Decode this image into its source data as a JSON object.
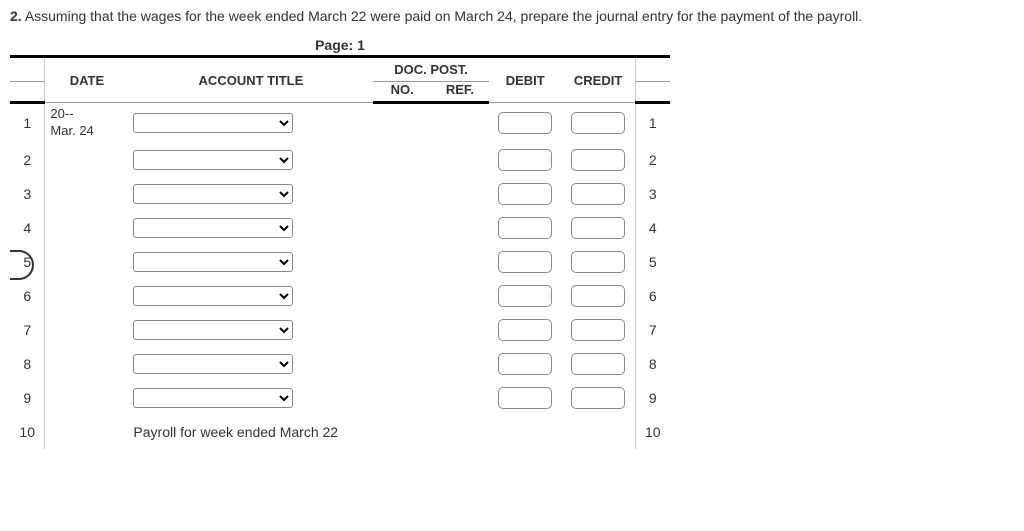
{
  "question": {
    "number": "2.",
    "text": "Assuming that the wages for the week ended March 22 were paid on March 24, prepare the journal entry for the payment of the payroll."
  },
  "page_label": "Page: 1",
  "headers": {
    "date": "DATE",
    "account_title": "ACCOUNT TITLE",
    "doc_post": "DOC. POST.",
    "doc_no": "NO.",
    "post_ref": "REF.",
    "debit": "DEBIT",
    "credit": "CREDIT"
  },
  "rows": [
    {
      "n": "1",
      "date_top": "20--",
      "date_bot": "Mar. 24",
      "has_select": true,
      "has_amounts": true,
      "note": ""
    },
    {
      "n": "2",
      "date_top": "",
      "date_bot": "",
      "has_select": true,
      "has_amounts": true,
      "note": ""
    },
    {
      "n": "3",
      "date_top": "",
      "date_bot": "",
      "has_select": true,
      "has_amounts": true,
      "note": ""
    },
    {
      "n": "4",
      "date_top": "",
      "date_bot": "",
      "has_select": true,
      "has_amounts": true,
      "note": ""
    },
    {
      "n": "5",
      "date_top": "",
      "date_bot": "",
      "has_select": true,
      "has_amounts": true,
      "note": ""
    },
    {
      "n": "6",
      "date_top": "",
      "date_bot": "",
      "has_select": true,
      "has_amounts": true,
      "note": ""
    },
    {
      "n": "7",
      "date_top": "",
      "date_bot": "",
      "has_select": true,
      "has_amounts": true,
      "note": ""
    },
    {
      "n": "8",
      "date_top": "",
      "date_bot": "",
      "has_select": true,
      "has_amounts": true,
      "note": ""
    },
    {
      "n": "9",
      "date_top": "",
      "date_bot": "",
      "has_select": true,
      "has_amounts": true,
      "note": ""
    },
    {
      "n": "10",
      "date_top": "",
      "date_bot": "",
      "has_select": false,
      "has_amounts": false,
      "note": "Payroll for week ended March 22"
    }
  ]
}
